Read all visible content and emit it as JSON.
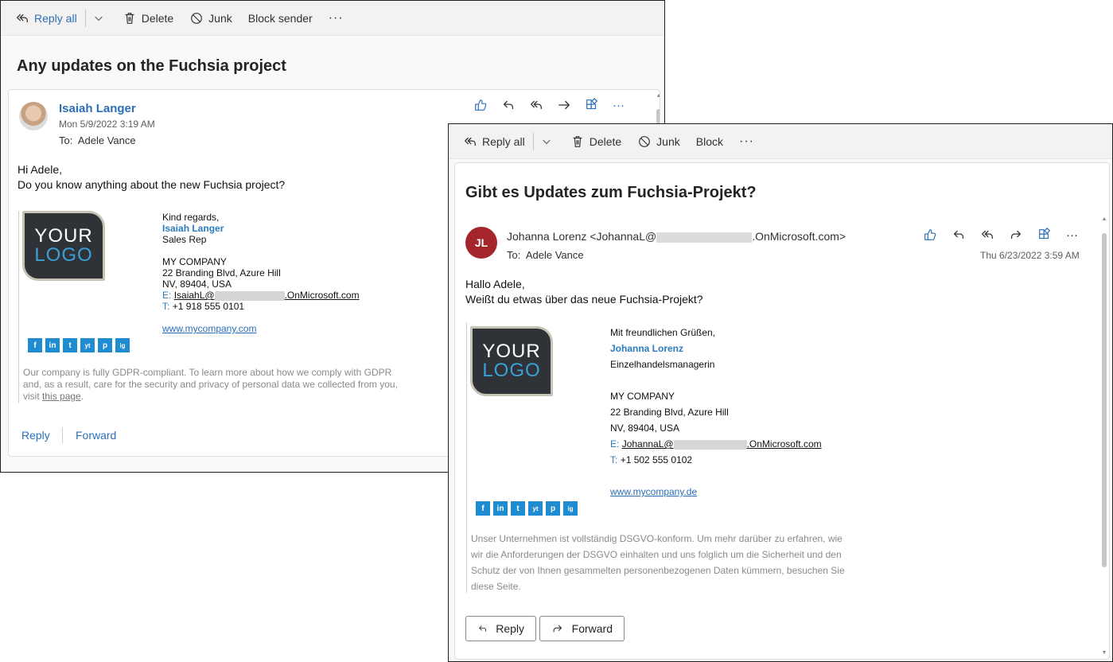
{
  "window1": {
    "toolbar": {
      "reply_all": "Reply all",
      "delete": "Delete",
      "junk": "Junk",
      "block": "Block sender",
      "more": "···"
    },
    "subject": "Any updates on the Fuchsia project",
    "sender": {
      "name": "Isaiah Langer",
      "date": "Mon 5/9/2022 3:19 AM",
      "to_label": "To:",
      "to": "Adele Vance"
    },
    "body": {
      "greeting": "Hi Adele,",
      "line1": "Do you know anything about the new Fuchsia project?"
    },
    "signature": {
      "logo_top": "YOUR",
      "logo_bottom": "LOGO",
      "closing": "Kind regards,",
      "name": "Isaiah Langer",
      "title": "Sales Rep",
      "company": "MY COMPANY",
      "address1": "22 Branding Blvd, Azure Hill",
      "address2": "NV, 89404, USA",
      "email_label": "E:",
      "email_user": "IsaiahL@",
      "email_domain": ".OnMicrosoft.com",
      "phone_label": "T:",
      "phone": "+1 918 555 0101",
      "website": "www.mycompany.com"
    },
    "gdpr": {
      "line1": "Our company is fully GDPR-compliant. To learn more about how we comply with GDPR",
      "line2": "and, as a result, care for the security and privacy of personal data we collected from you,",
      "line3_prefix": "visit",
      "line3_link": "this page",
      "line3_suffix": "."
    },
    "footer": {
      "reply": "Reply",
      "forward": "Forward"
    }
  },
  "window2": {
    "toolbar": {
      "reply_all": "Reply all",
      "delete": "Delete",
      "junk": "Junk",
      "block": "Block",
      "more": "···"
    },
    "subject": "Gibt es Updates zum Fuchsia-Projekt?",
    "sender": {
      "initials": "JL",
      "name_prefix": "Johanna Lorenz <JohannaL@",
      "name_suffix": ".OnMicrosoft.com>",
      "to_label": "To:",
      "to": "Adele Vance",
      "date": "Thu 6/23/2022 3:59 AM"
    },
    "body": {
      "greeting": "Hallo Adele,",
      "line1": "Weißt du etwas über das neue Fuchsia-Projekt?"
    },
    "signature": {
      "logo_top": "YOUR",
      "logo_bottom": "LOGO",
      "closing": "Mit freundlichen Grüßen,",
      "name": "Johanna Lorenz",
      "title": "Einzelhandelsmanagerin",
      "company": "MY COMPANY",
      "address1": "22 Branding Blvd, Azure Hill",
      "address2": "NV, 89404, USA",
      "email_label": "E:",
      "email_user": "JohannaL@",
      "email_domain": ".OnMicrosoft.com",
      "phone_label": "T:",
      "phone": "+1 502 555 0102",
      "website": "www.mycompany.de"
    },
    "gdpr": {
      "line1": "Unser Unternehmen ist vollständig DSGVO-konform. Um mehr darüber zu erfahren, wie",
      "line2": "wir die Anforderungen der DSGVO einhalten und uns folglich um die Sicherheit und den",
      "line3": "Schutz der von Ihnen gesammelten personenbezogenen Daten kümmern, besuchen Sie",
      "line4": "diese Seite."
    },
    "footer": {
      "reply": "Reply",
      "forward": "Forward"
    }
  },
  "social": {
    "facebook": "f",
    "linkedin": "in",
    "twitter": "t",
    "youtube": "yt",
    "pinterest": "p",
    "instagram": "ig"
  }
}
